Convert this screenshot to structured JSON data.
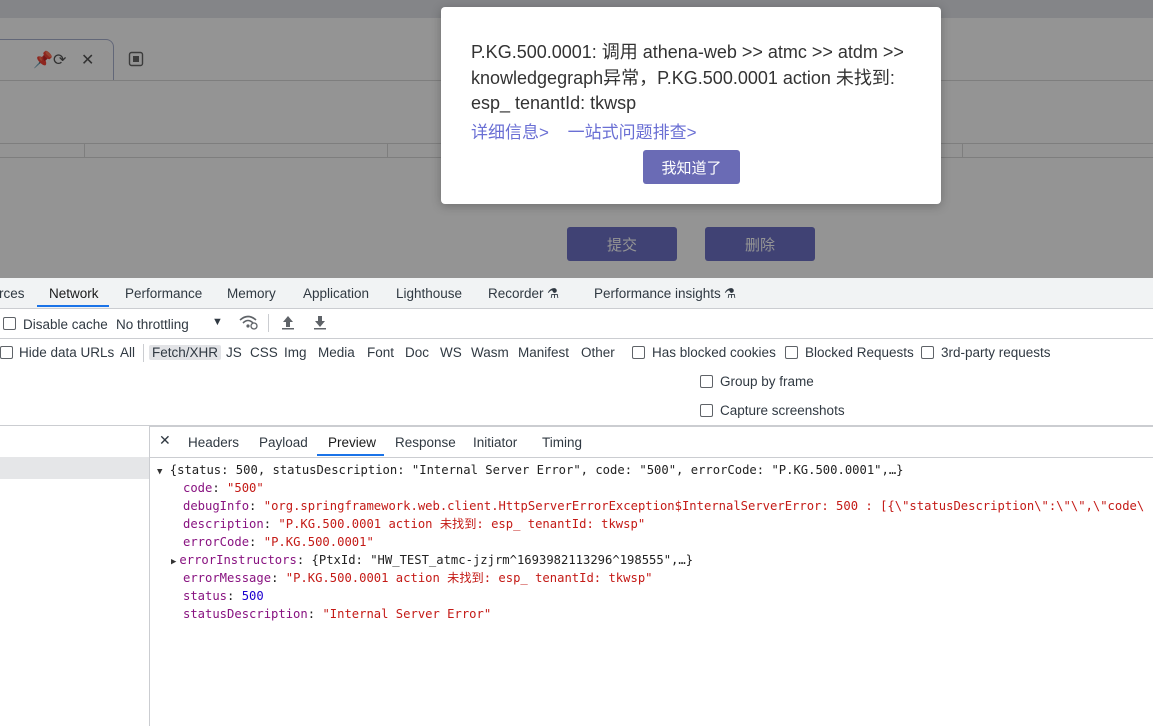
{
  "app": {
    "buttons": {
      "submit": "提交",
      "delete": "删除"
    }
  },
  "modal": {
    "message": "P.KG.500.0001: 调用 athena-web >> atmc >> atdm >> knowledgegraph异常，P.KG.500.0001 action 未找到: esp_ tenantId: tkwsp",
    "link_details": "详细信息>",
    "link_troubleshoot": "一站式问题排查>",
    "ok_button": "我知道了"
  },
  "devtools": {
    "panel_tabs": [
      "rces",
      "Network",
      "Performance",
      "Memory",
      "Application",
      "Lighthouse",
      "Recorder",
      "Performance insights"
    ],
    "active_panel": "Network",
    "toolbar": {
      "disable_cache": "Disable cache",
      "throttling": "No throttling"
    },
    "filter_bar": {
      "hide_data_urls": "Hide data URLs",
      "types": [
        "All",
        "Fetch/XHR",
        "JS",
        "CSS",
        "Img",
        "Media",
        "Font",
        "Doc",
        "WS",
        "Wasm",
        "Manifest",
        "Other"
      ],
      "selected_type": "Fetch/XHR",
      "has_blocked_cookies": "Has blocked cookies",
      "blocked_requests": "Blocked Requests",
      "third_party": "3rd-party requests"
    },
    "options": {
      "group_by_frame": "Group by frame",
      "capture_screenshots": "Capture screenshots"
    },
    "detail_tabs": [
      "Headers",
      "Payload",
      "Preview",
      "Response",
      "Initiator",
      "Timing"
    ],
    "active_detail_tab": "Preview",
    "preview": {
      "summary": "{status: 500, statusDescription: \"Internal Server Error\", code: \"500\", errorCode: \"P.KG.500.0001\",…}",
      "fields": [
        {
          "key": "code",
          "value": "\"500\"",
          "kind": "str"
        },
        {
          "key": "debugInfo",
          "value": "\"org.springframework.web.client.HttpServerErrorException$InternalServerError: 500 : [{\\\"statusDescription\\\":\\\"\\\",\\\"code\\",
          "kind": "str"
        },
        {
          "key": "description",
          "value": "\"P.KG.500.0001 action 未找到: esp_ tenantId: tkwsp\"",
          "kind": "str"
        },
        {
          "key": "errorCode",
          "value": "\"P.KG.500.0001\"",
          "kind": "str"
        },
        {
          "key": "errorInstructors",
          "value": "{PtxId: \"HW_TEST_atmc-jzjrm^1693982113296^198555\",…}",
          "kind": "obj"
        },
        {
          "key": "errorMessage",
          "value": "\"P.KG.500.0001 action 未找到: esp_ tenantId: tkwsp\"",
          "kind": "str"
        },
        {
          "key": "status",
          "value": "500",
          "kind": "num"
        },
        {
          "key": "statusDescription",
          "value": "\"Internal Server Error\"",
          "kind": "str"
        }
      ]
    }
  },
  "colors": {
    "accent": "#6a6bb5",
    "link": "#6a6fd4",
    "devtools_active": "#1a73e8"
  }
}
